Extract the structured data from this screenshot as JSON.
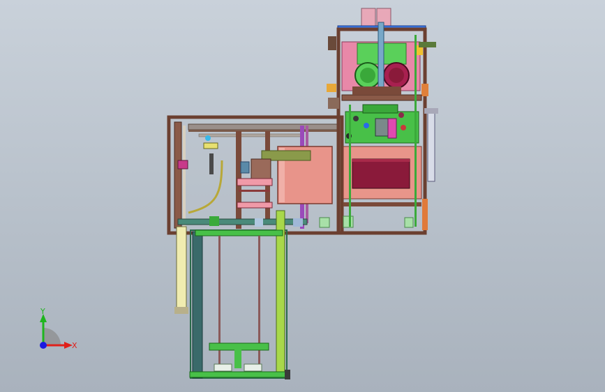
{
  "viewport": {
    "background_top": "#c9d1da",
    "background_bottom": "#a9b2bd"
  },
  "triad": {
    "x_label": "X",
    "y_label": "Y",
    "x_color": "#e0201a",
    "y_color": "#1eb51e",
    "z_color": "#1a1ae0"
  },
  "model": {
    "frame_color": "#7a4a3a",
    "frame_dark": "#5a3428",
    "green_part": "#41c841",
    "pink_part": "#e87a9a",
    "salmon_part": "#e8928a",
    "maroon_part": "#8a1a3a",
    "blue_part": "#3a7ae8"
  }
}
